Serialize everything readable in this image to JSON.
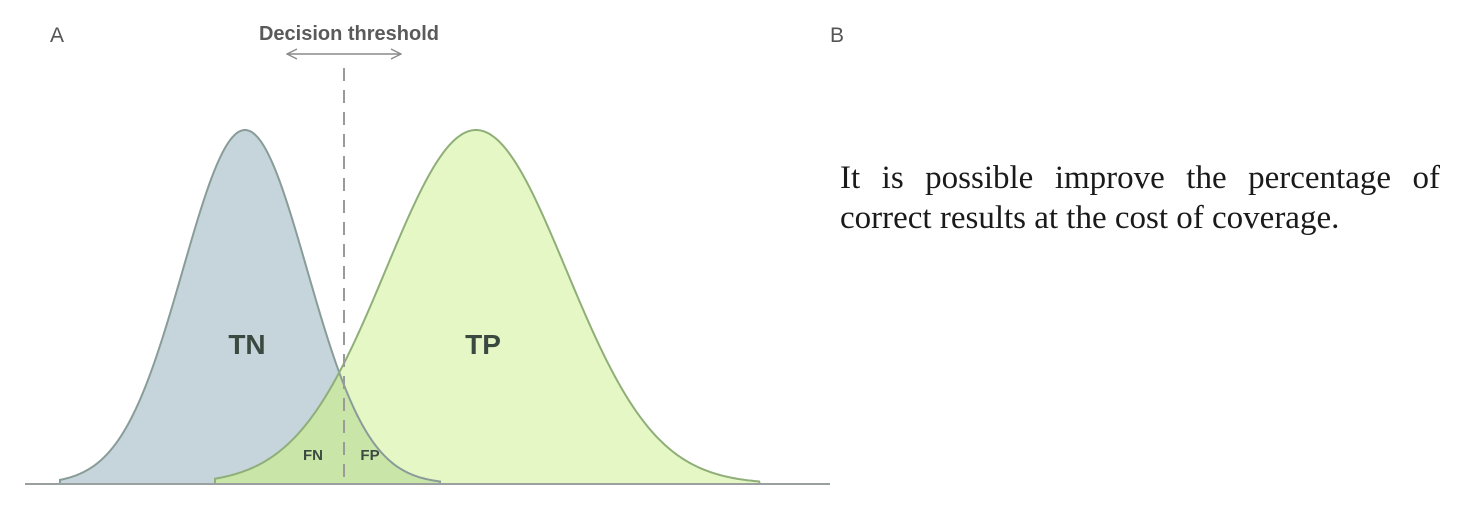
{
  "panels": {
    "left_label": "A",
    "right_label": "B"
  },
  "diagram": {
    "threshold_label": "Decision threshold",
    "regions": {
      "tn": "TN",
      "tp": "TP",
      "fn": "FN",
      "fp": "FP"
    },
    "colors": {
      "negative_fill": "#c5d5db",
      "negative_stroke": "#8a9c98",
      "positive_fill": "#e6f7c6",
      "positive_stroke": "#8fae78",
      "overlap_fill": "#c9e6a8",
      "threshold_line": "#9a9a9a",
      "baseline": "#9aa0a0",
      "label_text": "#3a4a40"
    }
  },
  "caption": {
    "line1": "It is possible improve the percentage of",
    "line2": "correct results at the cost of coverage."
  }
}
